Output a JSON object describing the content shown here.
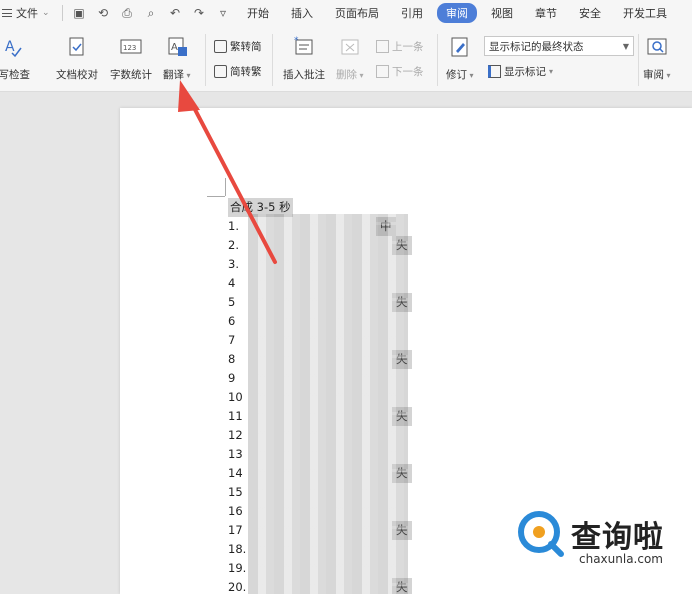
{
  "menubar": {
    "file_label": "文件",
    "tabs": [
      {
        "label": "开始",
        "active": false
      },
      {
        "label": "插入",
        "active": false
      },
      {
        "label": "页面布局",
        "active": false
      },
      {
        "label": "引用",
        "active": false
      },
      {
        "label": "审阅",
        "active": true
      },
      {
        "label": "视图",
        "active": false
      },
      {
        "label": "章节",
        "active": false
      },
      {
        "label": "安全",
        "active": false
      },
      {
        "label": "开发工具",
        "active": false
      }
    ]
  },
  "ribbon": {
    "spell_check": "拼写检查",
    "doc_proof": "文档校对",
    "word_count": "字数统计",
    "translate": "翻译",
    "trad_to_simp": "繁转简",
    "simp_to_trad": "简转繁",
    "insert_comment": "插入批注",
    "delete": "删除",
    "prev": "上一条",
    "next": "下一条",
    "track_changes": "修订",
    "markup_state": "显示标记的最终状态",
    "show_markup": "显示标记",
    "review": "审阅"
  },
  "document": {
    "title": "合成 3-5 秒",
    "lines": [
      {
        "num": "1.",
        "tail": "中"
      },
      {
        "num": "2.",
        "tail": "失"
      },
      {
        "num": "3.",
        "tail": ""
      },
      {
        "num": "4",
        "tail": ""
      },
      {
        "num": "5",
        "tail": "失"
      },
      {
        "num": "6",
        "tail": ""
      },
      {
        "num": "7",
        "tail": ""
      },
      {
        "num": "8",
        "tail": "失"
      },
      {
        "num": "9",
        "tail": ""
      },
      {
        "num": "10",
        "tail": ""
      },
      {
        "num": "11",
        "tail": "失"
      },
      {
        "num": "12",
        "tail": ""
      },
      {
        "num": "13",
        "tail": ""
      },
      {
        "num": "14",
        "tail": "失"
      },
      {
        "num": "15",
        "tail": ""
      },
      {
        "num": "16",
        "tail": ""
      },
      {
        "num": "17",
        "tail": "失"
      },
      {
        "num": "18.",
        "tail": ""
      },
      {
        "num": "19.",
        "tail": ""
      },
      {
        "num": "20.",
        "tail": "失"
      }
    ]
  },
  "watermark": {
    "brand": "查询啦",
    "url": "chaxunla.com"
  },
  "colors": {
    "accent": "#4d7ed8",
    "arrow": "#e8493f",
    "watermark_blue": "#2a8ad8",
    "watermark_orange": "#f0a020"
  }
}
